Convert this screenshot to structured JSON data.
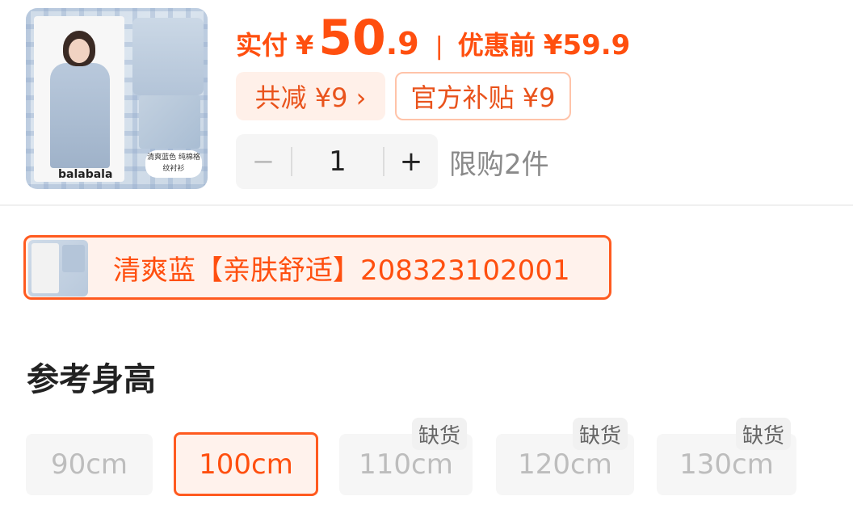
{
  "product": {
    "image_brand": "balabala",
    "image_tag": "清爽蓝色 纯棉格纹衬衫"
  },
  "price": {
    "label": "实付",
    "currency": "¥",
    "integer": "50",
    "decimal": ".9",
    "separator": "|",
    "original_label": "优惠前",
    "original_price": "¥59.9"
  },
  "discounts": {
    "total": "共减 ¥9 ›",
    "subsidy": "官方补贴 ¥9"
  },
  "quantity": {
    "minus": "−",
    "value": "1",
    "plus": "+",
    "limit": "限购2件"
  },
  "variant": {
    "name": "清爽蓝【亲肤舒适】208323102001"
  },
  "size_section": {
    "title": "参考身高",
    "options": [
      {
        "label": "90cm",
        "badge": ""
      },
      {
        "label": "100cm",
        "badge": ""
      },
      {
        "label": "110cm",
        "badge": "缺货"
      },
      {
        "label": "120cm",
        "badge": "缺货"
      },
      {
        "label": "130cm",
        "badge": "缺货"
      }
    ],
    "selected": "100cm"
  },
  "colors": {
    "accent": "#ff4f0f",
    "accent_light": "#fff2ec",
    "muted": "#bdbdbd"
  }
}
